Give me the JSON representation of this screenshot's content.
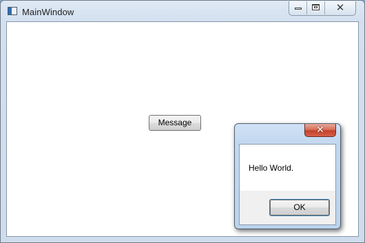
{
  "window": {
    "title": "MainWindow",
    "icon": "app-window-icon",
    "caption_icons": {
      "minimize": "minimize-icon",
      "maximize": "maximize-icon",
      "close": "close-icon",
      "close_glyph": "✕"
    }
  },
  "main": {
    "button_label": "Message"
  },
  "dialog": {
    "close_glyph": "✕",
    "message": "Hello World.",
    "ok_label": "OK"
  },
  "colors": {
    "frame": "#cfdcec",
    "client": "#ffffff",
    "dialog_frame": "#bcd3ec",
    "close_red": "#c4412a",
    "focus_border": "#3c7fb1"
  }
}
